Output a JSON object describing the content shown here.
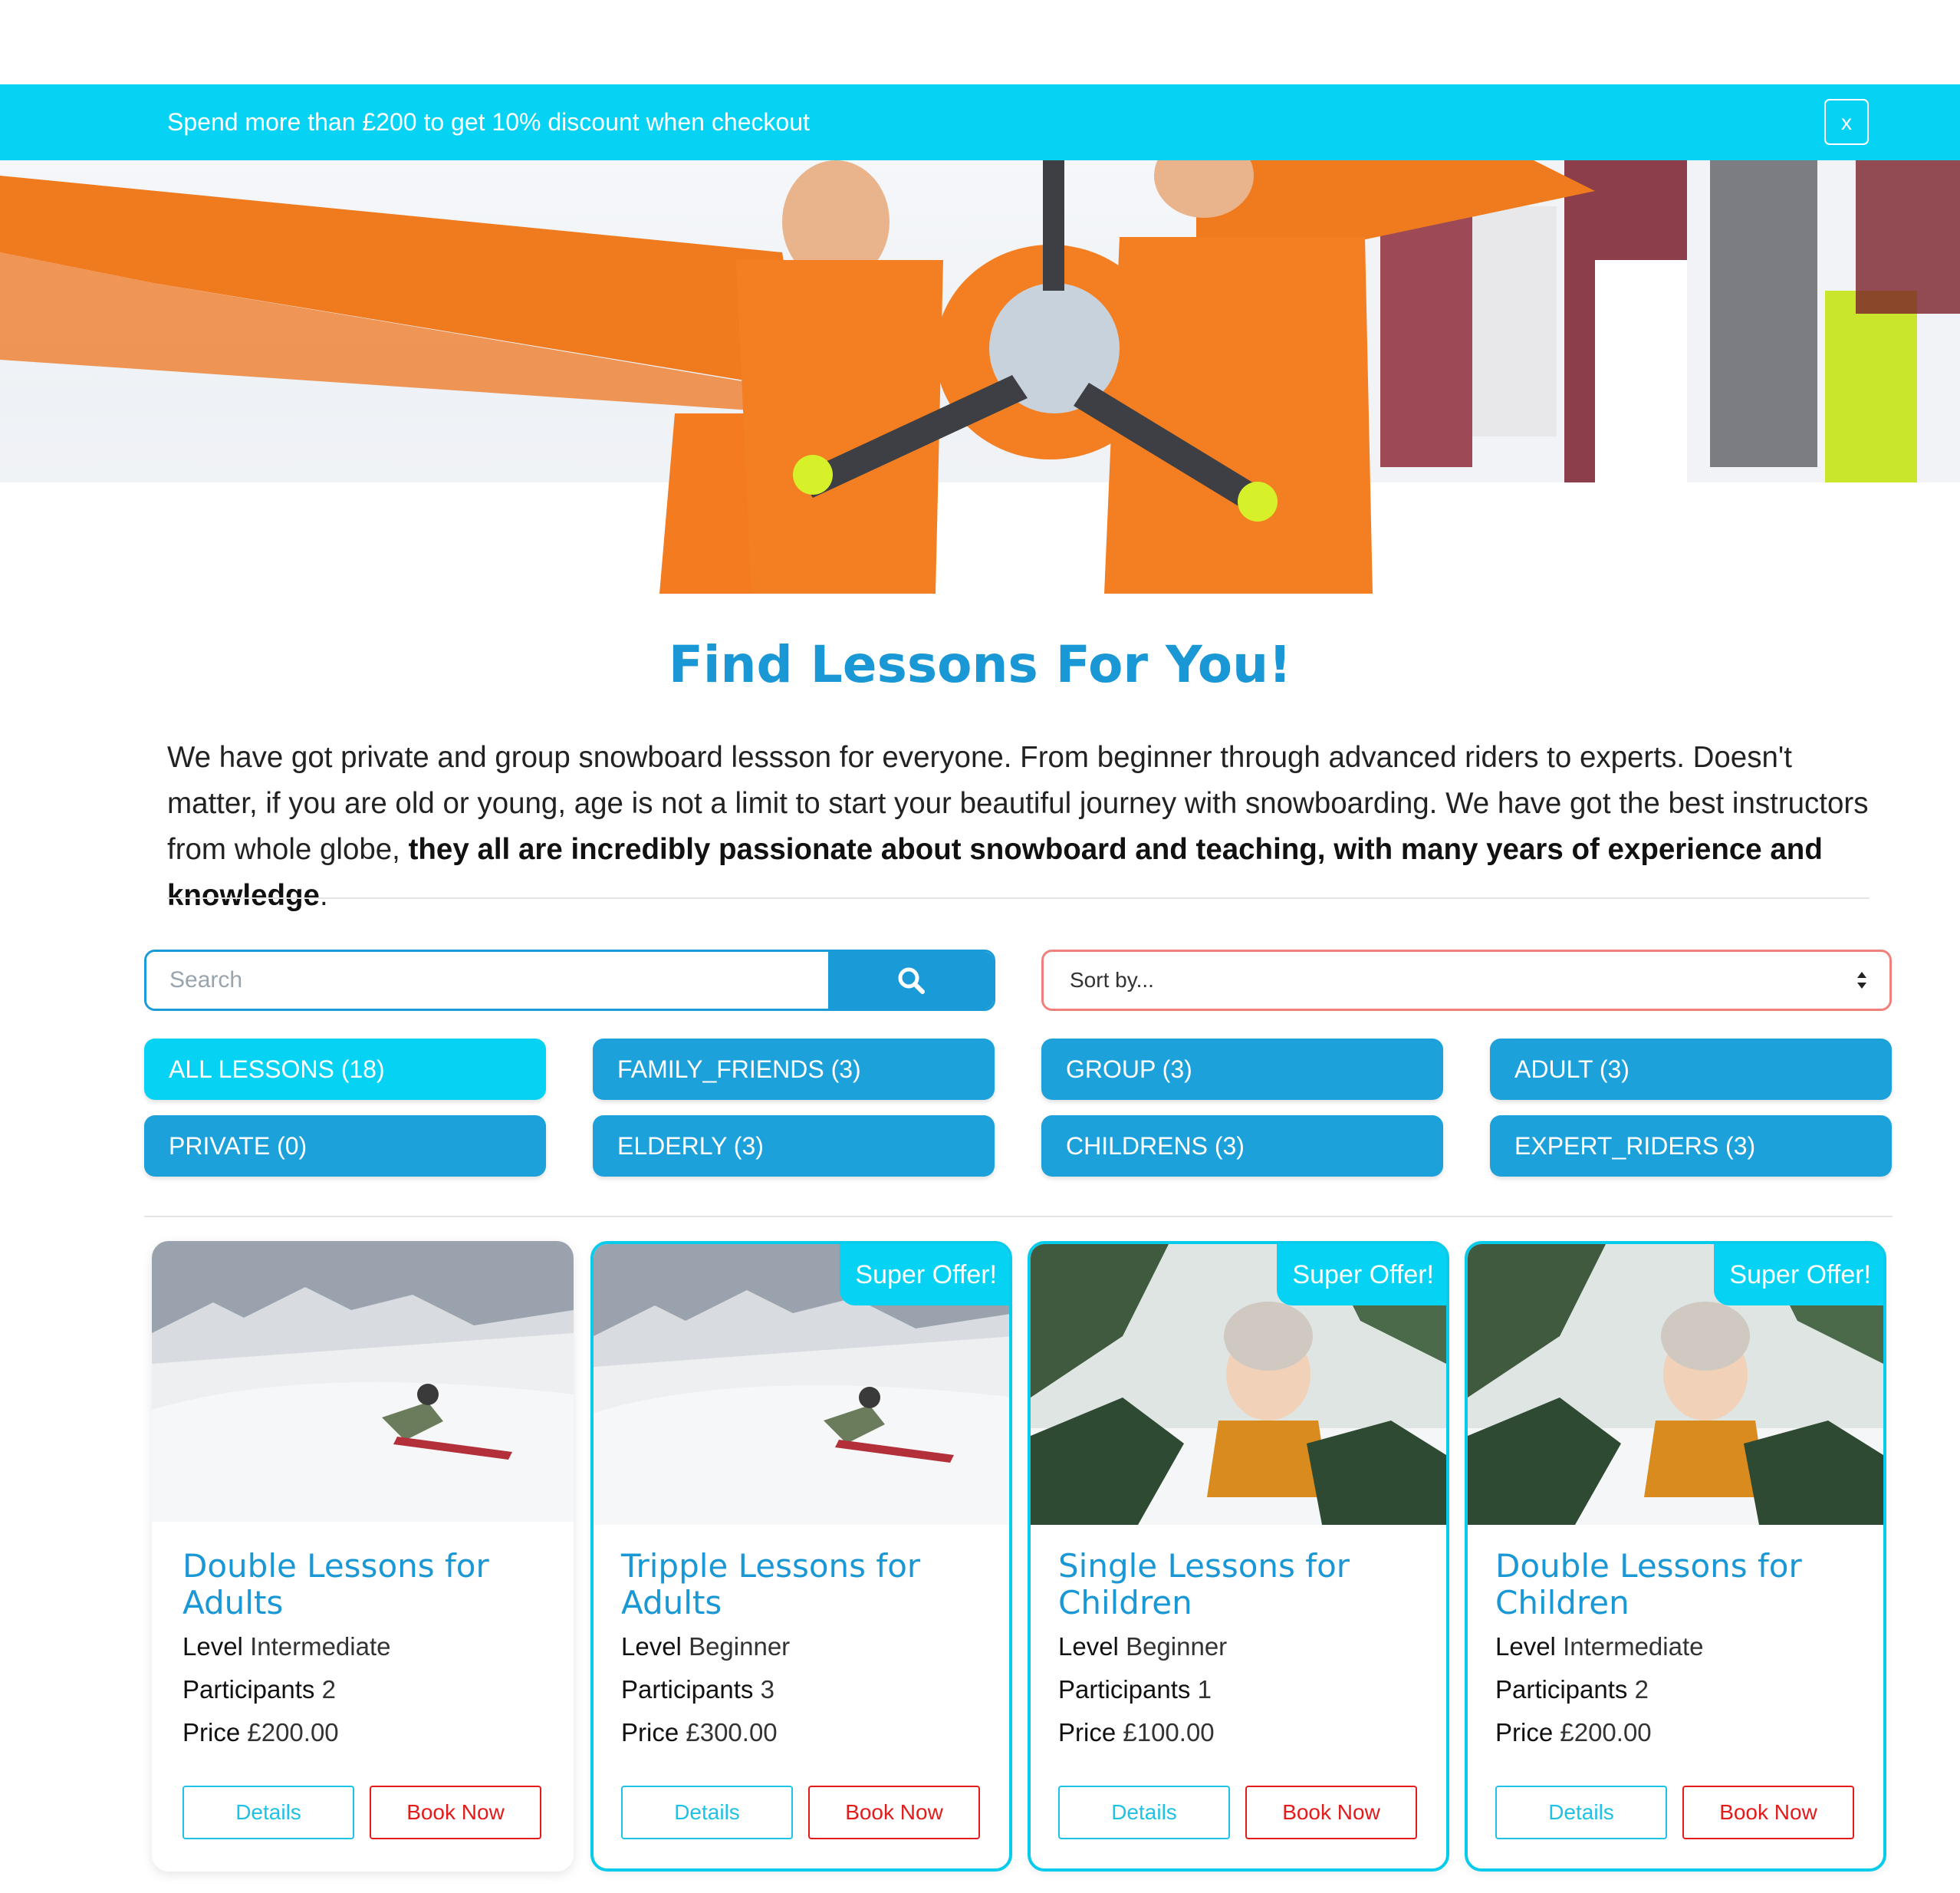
{
  "promo": {
    "text": "Spend more than £200 to get 10% discount when checkout",
    "close_label": "x"
  },
  "hero": {
    "image": "snowboarders-in-orange-airplane-costume"
  },
  "page": {
    "title": "Find Lessons For You!",
    "intro_text": "We have got private and group snowboard lessson for everyone. From beginner through advanced riders to experts. Doesn't matter, if you are old or young, age is not a limit to start your beautiful journey with snowboarding. We have got the best instructors from whole globe, ",
    "intro_bold": "they all are incredibly passionate about snowboard and teaching, with many years of experience and knowledge",
    "intro_end": "."
  },
  "search": {
    "placeholder": "Search",
    "icon": "search-icon"
  },
  "sort": {
    "selected": "Sort by..."
  },
  "filters": [
    {
      "label": "ALL LESSONS (18)",
      "active": true
    },
    {
      "label": "FAMILY_FRIENDS (3)",
      "active": false
    },
    {
      "label": "GROUP (3)",
      "active": false
    },
    {
      "label": "ADULT (3)",
      "active": false
    },
    {
      "label": "PRIVATE (0)",
      "active": false
    },
    {
      "label": "ELDERLY (3)",
      "active": false
    },
    {
      "label": "CHILDRENS (3)",
      "active": false
    },
    {
      "label": "EXPERT_RIDERS (3)",
      "active": false
    }
  ],
  "cards": [
    {
      "image": "snowboarder-on-slope",
      "badge": "",
      "title": "Double Lessons for Adults",
      "level_label": "Level",
      "level": "Intermediate",
      "participants_label": "Participants",
      "participants": "2",
      "price_label": "Price",
      "price": "£200.00",
      "details_label": "Details",
      "book_label": "Book Now"
    },
    {
      "image": "snowboarder-on-slope",
      "badge": "Super Offer!",
      "title": "Tripple Lessons for Adults",
      "level_label": "Level",
      "level": "Beginner",
      "participants_label": "Participants",
      "participants": "3",
      "price_label": "Price",
      "price": "£300.00",
      "details_label": "Details",
      "book_label": "Book Now"
    },
    {
      "image": "child-in-snow",
      "badge": "Super Offer!",
      "title": "Single Lessons for Children",
      "level_label": "Level",
      "level": "Beginner",
      "participants_label": "Participants",
      "participants": "1",
      "price_label": "Price",
      "price": "£100.00",
      "details_label": "Details",
      "book_label": "Book Now"
    },
    {
      "image": "child-in-snow",
      "badge": "Super Offer!",
      "title": "Double Lessons for Children",
      "level_label": "Level",
      "level": "Intermediate",
      "participants_label": "Participants",
      "participants": "2",
      "price_label": "Price",
      "price": "£200.00",
      "details_label": "Details",
      "book_label": "Book Now"
    }
  ],
  "colors": {
    "accent_cyan": "#06d3f3",
    "accent_blue": "#1da1db",
    "title_blue": "#1a97d5",
    "book_red": "#e21b1b",
    "sort_border": "#f0807c"
  }
}
